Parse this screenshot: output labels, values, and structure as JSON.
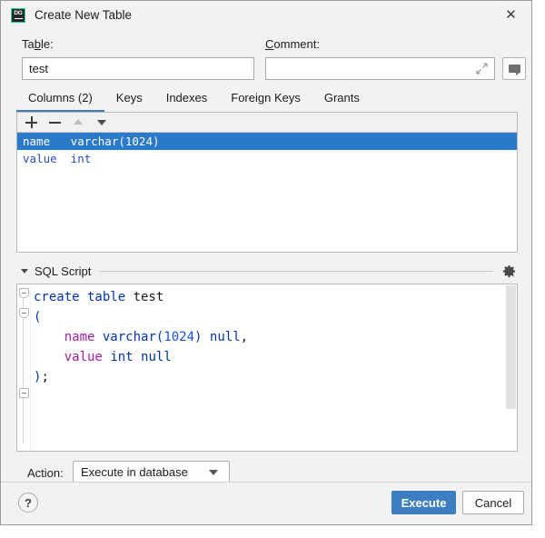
{
  "window": {
    "title": "Create New Table",
    "icon": "datagrip-icon",
    "icon_text": "DG",
    "close_label": "✕"
  },
  "form": {
    "table_label": "Table:",
    "table_label_mnemonic": "b",
    "table_value": "test",
    "comment_label": "Comment:",
    "comment_label_mnemonic": "C",
    "comment_value": "",
    "comment_placeholder": "",
    "expand_icon": "expand-diagonal-icon",
    "comment_button_icon": "speech-bubble-icon"
  },
  "tabs": [
    {
      "label": "Columns (2)",
      "active": true
    },
    {
      "label": "Keys",
      "active": false
    },
    {
      "label": "Indexes",
      "active": false
    },
    {
      "label": "Foreign Keys",
      "active": false
    },
    {
      "label": "Grants",
      "active": false
    }
  ],
  "columns_toolbar": [
    {
      "name": "add-column-button",
      "icon": "plus-icon",
      "enabled": true
    },
    {
      "name": "remove-column-button",
      "icon": "minus-icon",
      "enabled": true
    },
    {
      "name": "move-up-button",
      "icon": "arrow-up-icon",
      "enabled": false
    },
    {
      "name": "move-down-button",
      "icon": "arrow-down-icon",
      "enabled": true
    }
  ],
  "columns": [
    {
      "name": "name",
      "type": "varchar(1024)",
      "text": "name   varchar(1024)",
      "selected": true
    },
    {
      "name": "value",
      "type": "int",
      "text": "value  int",
      "selected": false
    }
  ],
  "sql_section": {
    "title": "SQL Script",
    "title_mnemonic": "S",
    "collapsed": false,
    "settings_icon": "gear-icon",
    "lines": [
      {
        "tokens": [
          {
            "t": "create table ",
            "c": "kw"
          },
          {
            "t": "test",
            "c": "ident"
          }
        ]
      },
      {
        "tokens": [
          {
            "t": "(",
            "c": "paren"
          }
        ]
      },
      {
        "tokens": [
          {
            "t": "    ",
            "c": "ident"
          },
          {
            "t": "name",
            "c": "col"
          },
          {
            "t": " ",
            "c": "ident"
          },
          {
            "t": "varchar",
            "c": "kw"
          },
          {
            "t": "(",
            "c": "paren"
          },
          {
            "t": "1024",
            "c": "num"
          },
          {
            "t": ")",
            "c": "paren"
          },
          {
            "t": " ",
            "c": "ident"
          },
          {
            "t": "null",
            "c": "kw"
          },
          {
            "t": ",",
            "c": "punc"
          }
        ]
      },
      {
        "tokens": [
          {
            "t": "    ",
            "c": "ident"
          },
          {
            "t": "value",
            "c": "col"
          },
          {
            "t": " ",
            "c": "ident"
          },
          {
            "t": "int",
            "c": "kw"
          },
          {
            "t": " ",
            "c": "ident"
          },
          {
            "t": "null",
            "c": "kw"
          }
        ]
      },
      {
        "tokens": [
          {
            "t": ")",
            "c": "paren"
          },
          {
            "t": ";",
            "c": "punc"
          }
        ]
      }
    ],
    "plain_text": "create table test\n(\n    name varchar(1024) null,\n    value int null\n);"
  },
  "action": {
    "label": "Action:",
    "selected": "Execute in database"
  },
  "footer": {
    "help_label": "?",
    "execute_label": "Execute",
    "cancel_label": "Cancel"
  },
  "colors": {
    "accent": "#3d7ec2",
    "selection": "#2a7ac9",
    "keyword": "#0033b3",
    "column": "#a11ca6",
    "number": "#1750eb",
    "brand_green": "#21d789",
    "dialog_bg": "#f2f2f2"
  }
}
